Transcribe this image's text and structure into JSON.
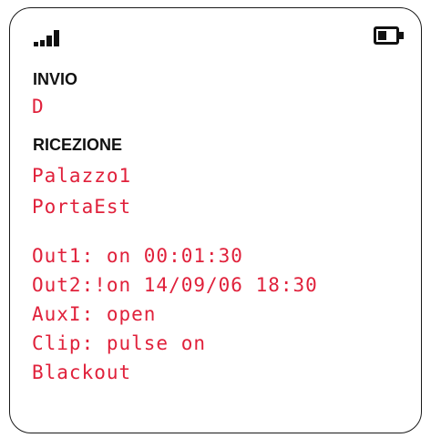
{
  "status": {
    "signal_icon": "signal-strength-icon",
    "battery_icon": "battery-icon",
    "battery_level": 0.5
  },
  "invio": {
    "title": "INVIO",
    "value": "D"
  },
  "ricezione": {
    "title": "RICEZIONE",
    "lines": [
      "Palazzo1",
      "PortaEst"
    ],
    "status_lines": [
      "Out1: on 00:01:30",
      "Out2:!on 14/09/06 18:30",
      "AuxI: open",
      "Clip: pulse on",
      "Blackout"
    ]
  },
  "colors": {
    "lcd_text": "#e0213b",
    "label_text": "#111111"
  }
}
